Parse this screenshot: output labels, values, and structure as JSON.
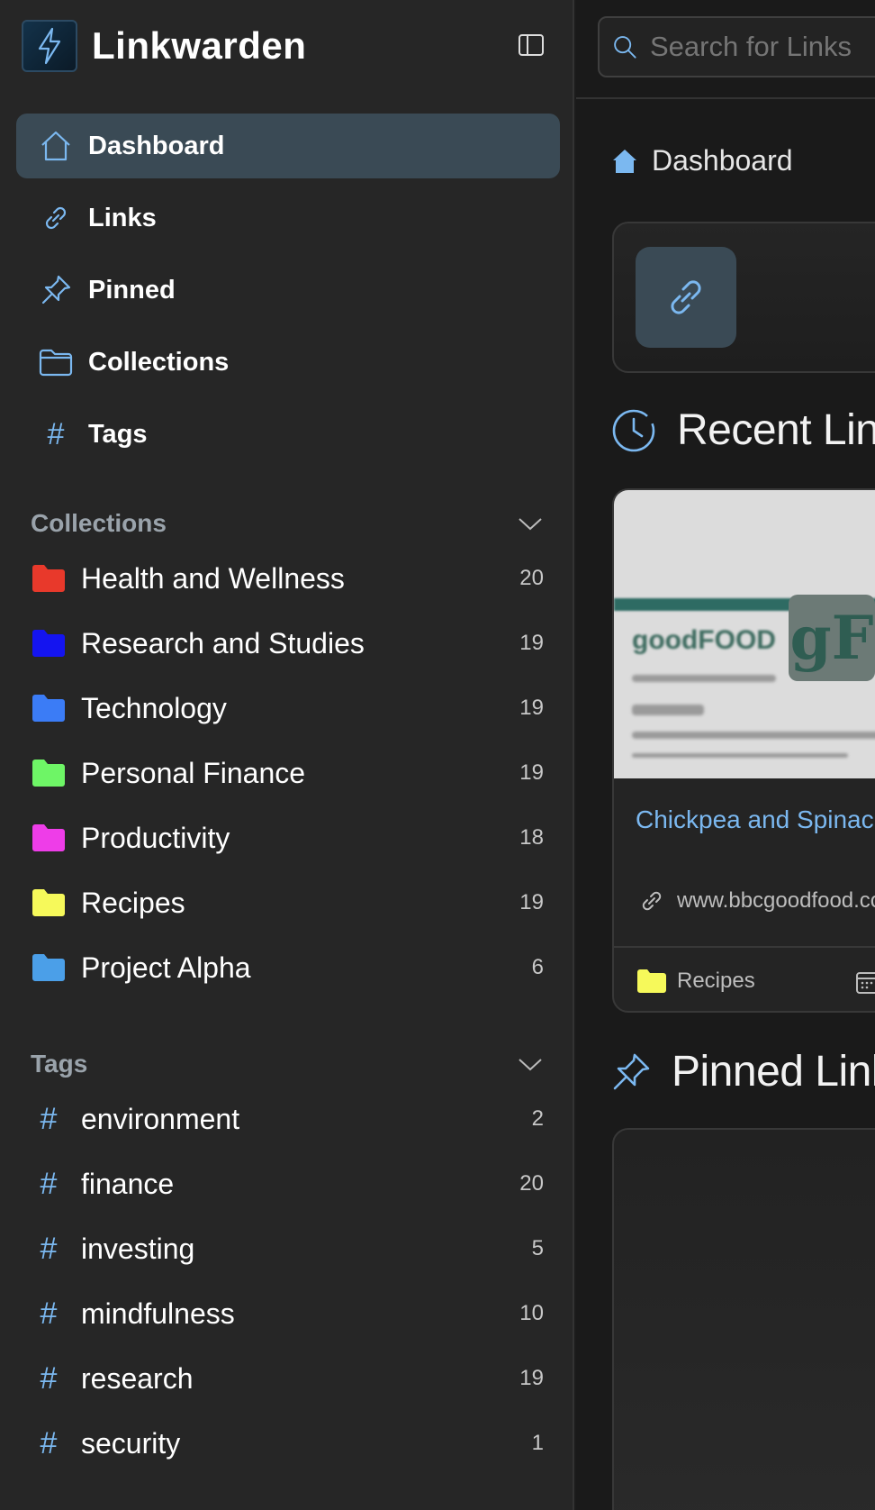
{
  "app": {
    "name": "Linkwarden"
  },
  "nav": {
    "items": [
      {
        "label": "Dashboard",
        "icon": "home-icon",
        "active": true
      },
      {
        "label": "Links",
        "icon": "link-icon"
      },
      {
        "label": "Pinned",
        "icon": "pin-icon"
      },
      {
        "label": "Collections",
        "icon": "folder-icon"
      },
      {
        "label": "Tags",
        "icon": "hash-icon"
      }
    ]
  },
  "collections": {
    "title": "Collections",
    "items": [
      {
        "label": "Health and Wellness",
        "count": "20",
        "color": "#e8392b"
      },
      {
        "label": "Research and Studies",
        "count": "19",
        "color": "#1414f0"
      },
      {
        "label": "Technology",
        "count": "19",
        "color": "#3b7cf6"
      },
      {
        "label": "Personal Finance",
        "count": "19",
        "color": "#6ef566"
      },
      {
        "label": "Productivity",
        "count": "18",
        "color": "#ee3de8"
      },
      {
        "label": "Recipes",
        "count": "19",
        "color": "#f6f95a"
      },
      {
        "label": "Project Alpha",
        "count": "6",
        "color": "#4b9fe8"
      }
    ]
  },
  "tags": {
    "title": "Tags",
    "items": [
      {
        "label": "environment",
        "count": "2"
      },
      {
        "label": "finance",
        "count": "20"
      },
      {
        "label": "investing",
        "count": "5"
      },
      {
        "label": "mindfulness",
        "count": "10"
      },
      {
        "label": "research",
        "count": "19"
      },
      {
        "label": "security",
        "count": "1"
      }
    ]
  },
  "search": {
    "placeholder": "Search for Links"
  },
  "breadcrumb": {
    "label": "Dashboard"
  },
  "sections": {
    "recent": "Recent Links",
    "pinned": "Pinned Links"
  },
  "recent_card": {
    "title": "Chickpea and Spinach",
    "url": "www.bbcgoodfood.com",
    "collection": "Recipes",
    "collection_color": "#f6f95a",
    "preview_logo": "goodFOOD",
    "favicon": "gF"
  },
  "accent": "#7bb8f0"
}
